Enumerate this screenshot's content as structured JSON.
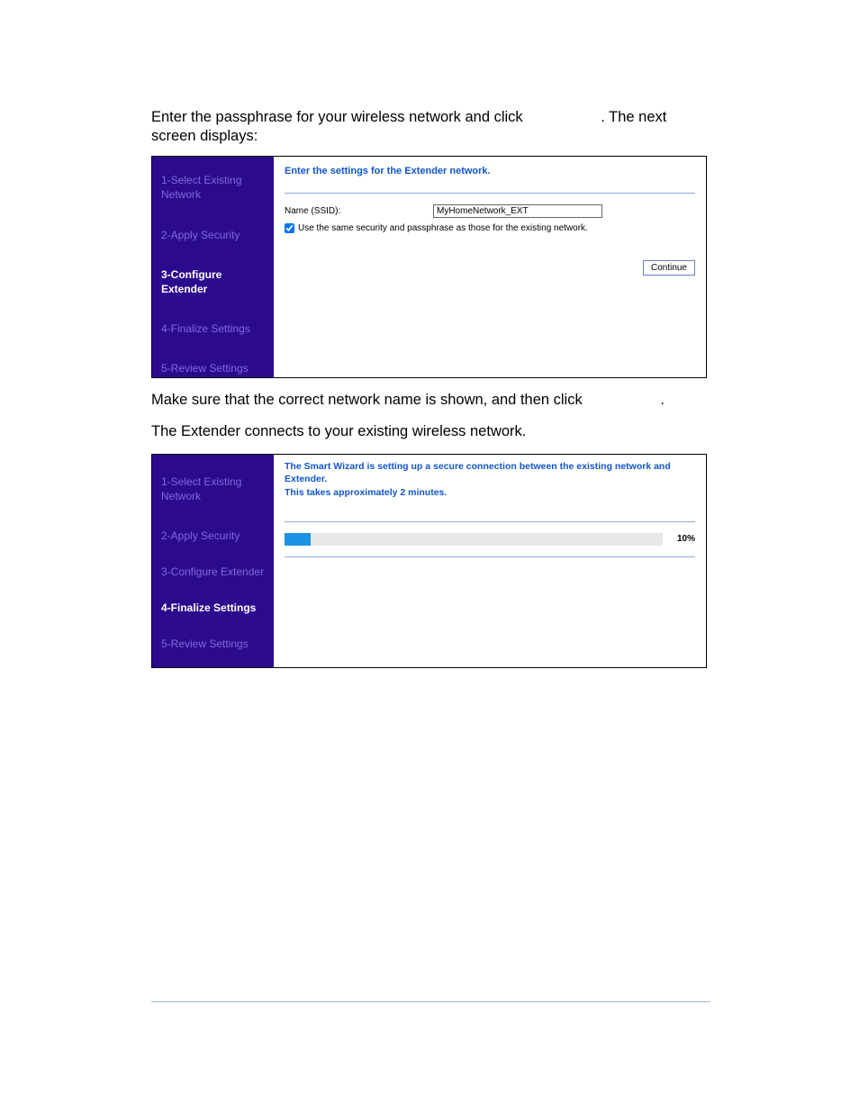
{
  "intro": {
    "line": "Enter the passphrase for your wireless network and click",
    "after": ". The next screen displays:"
  },
  "frame1": {
    "heading": "Enter the settings for the Extender network.",
    "name_label": "Name (SSID):",
    "ssid_value": "MyHomeNetwork_EXT",
    "checkbox_label": "Use the same security and passphrase as those for the existing network.",
    "continue_label": "Continue",
    "sidebar": [
      "1-Select Existing Network",
      "2-Apply Security",
      "3-Configure Extender",
      "4-Finalize Settings",
      "5-Review Settings"
    ]
  },
  "mid_text_1": "Make sure that the correct network name is shown, and then click",
  "mid_text_1_tail": ".",
  "mid_text_2": "The Extender connects to your existing wireless network.",
  "frame2": {
    "heading_line1": "The Smart Wizard is setting up a secure connection between the existing network and Extender.",
    "heading_line2": "This takes approximately 2 minutes.",
    "progress_pct": "10%",
    "sidebar": [
      "1-Select Existing Network",
      "2-Apply Security",
      "3-Configure Extender",
      "4-Finalize Settings",
      "5-Review Settings"
    ]
  }
}
